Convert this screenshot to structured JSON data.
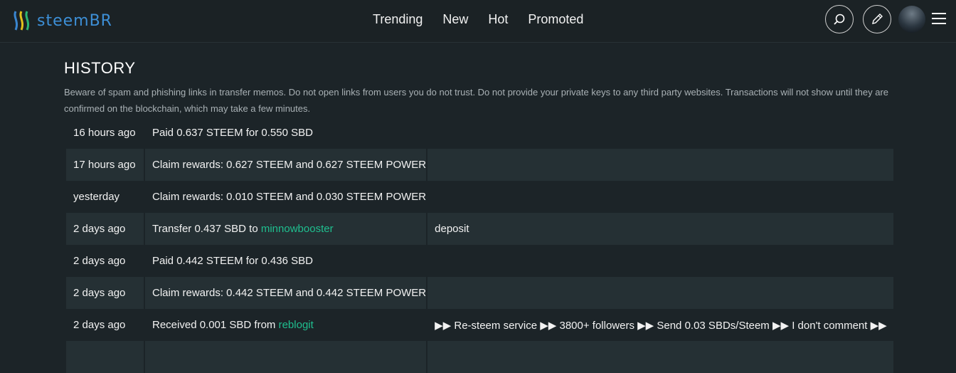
{
  "brand": {
    "name": "steemBR"
  },
  "nav": [
    "Trending",
    "New",
    "Hot",
    "Promoted"
  ],
  "header_icons": [
    "search-icon",
    "pencil-icon",
    "menu-icon"
  ],
  "history": {
    "title": "HISTORY",
    "notice": "Beware of spam and phishing links in transfer memos. Do not open links from users you do not trust. Do not provide your private keys to any third party websites. Transactions will not show until they are confirmed on the blockchain, which may take a few minutes.",
    "rows": [
      {
        "time": "16 hours ago",
        "desc": "Paid 0.637 STEEM for 0.550 SBD",
        "memo": ""
      },
      {
        "time": "17 hours ago",
        "desc": "Claim rewards: 0.627 STEEM and 0.627 STEEM POWER",
        "memo": ""
      },
      {
        "time": "yesterday",
        "desc": "Claim rewards: 0.010 STEEM and 0.030 STEEM POWER",
        "memo": ""
      },
      {
        "time": "2 days ago",
        "desc_prefix": "Transfer 0.437 SBD to ",
        "user": "minnowbooster",
        "memo": "deposit"
      },
      {
        "time": "2 days ago",
        "desc": "Paid 0.442 STEEM for 0.436 SBD",
        "memo": ""
      },
      {
        "time": "2 days ago",
        "desc": "Claim rewards: 0.442 STEEM and 0.442 STEEM POWER",
        "memo": ""
      },
      {
        "time": "2 days ago",
        "desc_prefix": "Received 0.001 SBD from ",
        "user": "reblogit",
        "memo": "▶▶ Re-steem service ▶▶ 3800+ followers ▶▶ Send 0.03 SBDs/Steem ▶▶ I don't comment ▶▶"
      }
    ]
  }
}
